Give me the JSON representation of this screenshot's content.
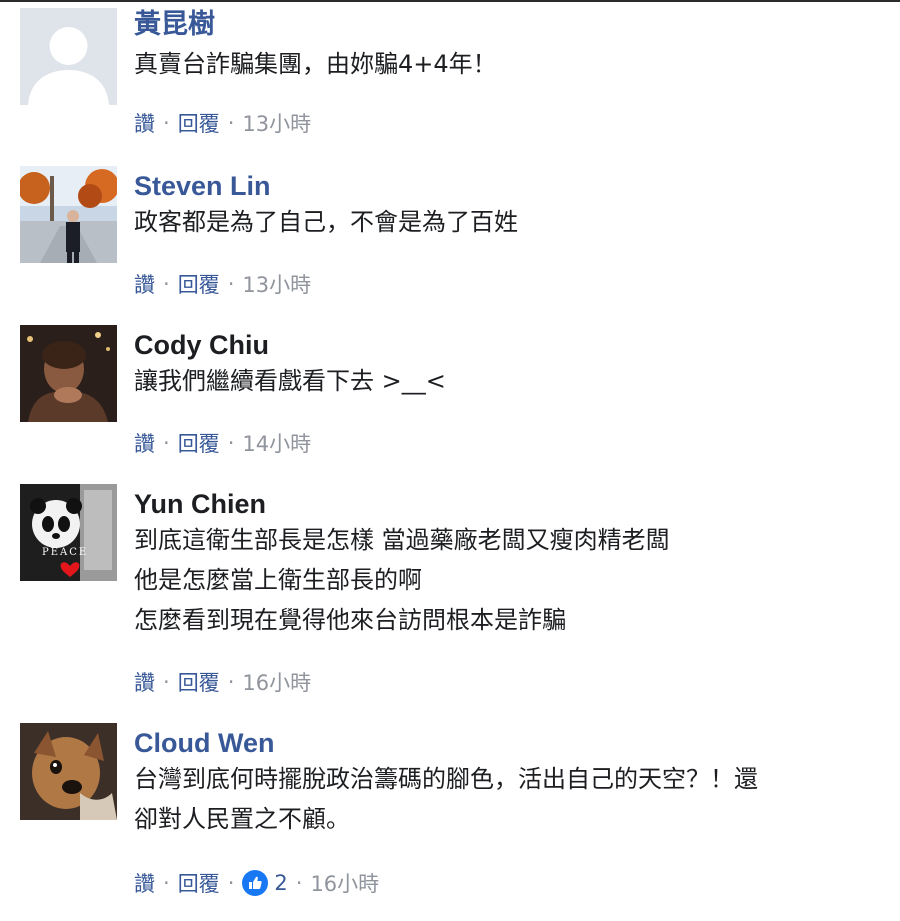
{
  "comments": [
    {
      "author": "黃昆樹",
      "lines": [
        "真賣台詐騙集團，由妳騙4+4年！"
      ],
      "like_label": "讚",
      "reply_label": "回覆",
      "time": "13小時",
      "avatar": "default-avatar"
    },
    {
      "author": "Steven Lin",
      "lines": [
        "政客都是為了自己，不會是為了百姓"
      ],
      "like_label": "讚",
      "reply_label": "回覆",
      "time": "13小時",
      "avatar": "photo-street-autumn"
    },
    {
      "author": "Cody Chiu",
      "lines": [
        "讓我們繼續看戲看下去 >__<"
      ],
      "like_label": "讚",
      "reply_label": "回覆",
      "time": "14小時",
      "avatar": "photo-person-dark"
    },
    {
      "author": "Yun Chien",
      "lines": [
        "到底這衛生部長是怎樣 當過藥廠老闆又瘦肉精老闆",
        "他是怎麼當上衛生部長的啊",
        "怎麼看到現在覺得他來台訪問根本是詐騙"
      ],
      "like_label": "讚",
      "reply_label": "回覆",
      "time": "16小時",
      "avatar": "photo-panda-peace"
    },
    {
      "author": "Cloud Wen",
      "lines": [
        "台灣到底何時擺脫政治籌碼的腳色，活出自己的天空？！還",
        "卻對人民置之不顧。"
      ],
      "like_label": "讚",
      "reply_label": "回覆",
      "reaction_count": "2",
      "time": "16小時",
      "avatar": "photo-dog"
    }
  ],
  "colors": {
    "link": "#385898",
    "text": "#1c1e21",
    "meta": "#90949c",
    "like_badge": "#1877f2"
  }
}
